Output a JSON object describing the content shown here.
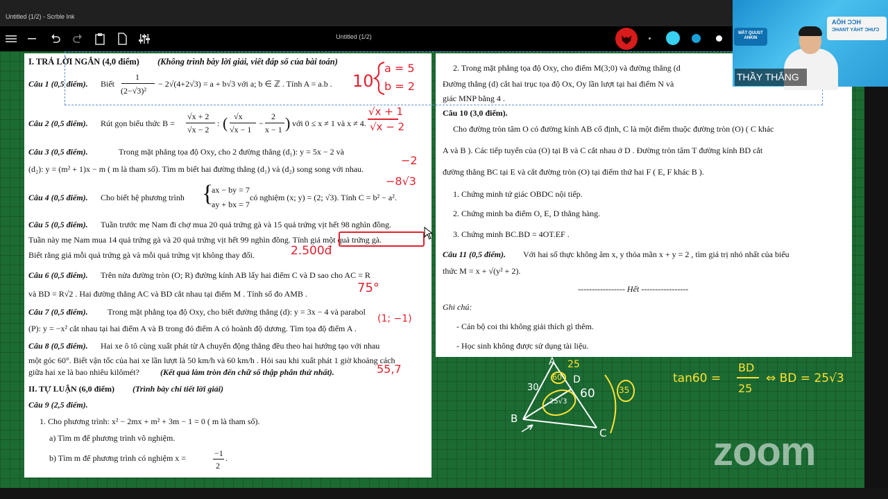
{
  "window": {
    "title": "Untitled (1/2) - Scrble Ink",
    "document_title": "Untitled (1/2)"
  },
  "toolbar": {
    "icons": [
      "menu-icon",
      "undo-icon",
      "redo-icon",
      "clipboard-icon",
      "page-icon",
      "sliders-icon",
      "fox-icon",
      "laser-icon"
    ]
  },
  "ink_colors": {
    "red": "#e0202d",
    "cyan": "#37d0f0",
    "teal": "#16a0d8",
    "white": "#ffffff",
    "yellow": "#ffe234"
  },
  "webcam": {
    "banner_line1": "AÔH ƆƆH",
    "banner_line2": "ƆHANT YẢHT ƆHƯƆ",
    "logo": "MẮT QUUST ANKIN",
    "name": "THẦY THẮNG"
  },
  "left_page": {
    "header": "I. TRẢ LỜI NGẮN (4,0 điểm)",
    "header_note": "(Không trình bày lời giải, viết đáp số của bài toán)",
    "q1_label": "Câu 1 (0,5 điểm).",
    "q1_pre": "Biết",
    "q1_frac_num": "1",
    "q1_frac_den": "(2−√3)²",
    "q1_rest": "− 2√(4+2√3) = a + b√3  với  a; b ∈ ℤ . Tính  A = a.b .",
    "q2_label": "Câu 2 (0,5 điểm).",
    "q2_pre": "Rút gọn biểu thức  B =",
    "q2_f1_num": "√x + 2",
    "q2_f1_den": "√x − 2",
    "q2_mid": ":",
    "q2_f2_num": "√x",
    "q2_f2_den": "√x − 1",
    "q2_minus": "−",
    "q2_f3_num": "2",
    "q2_f3_den": "x − 1",
    "q2_rest": "với  0 ≤ x ≠ 1  và  x ≠ 4.",
    "q3_label": "Câu 3 (0,5 điểm).",
    "q3_l1": "Trong mặt phẳng tọa độ  Oxy,  cho 2 đường thẳng  (d₁): y = 5x − 2  và",
    "q3_l2": "(d₂): y = (m² + 1)x − m  ( m  là tham số). Tìm  m  biết hai đường thẳng  (d₁)  và  (d₂)  song song với nhau.",
    "q4_label": "Câu 4 (0,5 điểm).",
    "q4_pre": "Cho biết hệ phương trình",
    "q4_sys1": "ax − by = 7",
    "q4_sys2": "ay + bx = 7",
    "q4_rest": "có nghiệm  (x; y) = (2; √3).  Tính  C = b² − a².",
    "q5_label": "Câu 5 (0,5 điểm).",
    "q5_l1": "Tuần trước mẹ Nam đi chợ mua  20  quả trứng gà và 15 quả trứng vịt hết  98  nghìn đồng.",
    "q5_l2": "Tuần này mẹ Nam mua 14 quả trứng gà và  20  quả trứng vịt hết 99  nghìn đồng. Tính giá một quả trứng gà.",
    "q5_l3": "Biết rằng giá mỗi quả trứng gà và mỗi quả trứng vịt không thay đổi.",
    "q6_label": "Câu 6 (0,5 điểm).",
    "q6_l1": "Trên nửa đường tròn  (O; R)  đường kính  AB  lấy hai điểm  C  và  D  sao cho  AC = R",
    "q6_l2": "và  BD = R√2 . Hai đường thẳng  AC  và  BD  cắt nhau tại điểm  M . Tính số đo  AMB .",
    "q7_label": "Câu 7 (0,5 điểm).",
    "q7_l1": "Trong mặt phẳng tọa độ  Oxy,  cho biết đường thẳng  (d): y = 3x − 4  và parabol",
    "q7_l2": "(P): y = −x²  cắt nhau tại hai điểm  A  và  B  trong đó điểm  A  có hoành độ dương. Tìm tọa độ điểm  A .",
    "q8_label": "Câu 8 (0,5 điểm).",
    "q8_l1": "Hai xe ô tô cùng xuất phát từ  A  chuyển động thẳng đều theo hai hướng tạo với nhau",
    "q8_l2": "một góc 60°. Biết vận tốc của hai xe lần lượt là 50 km/h và 60 km/h . Hỏi sau khi xuất phát 1 giờ khoảng cách",
    "q8_l3": "giữa hai xe là bao nhiêu kilômét?",
    "q8_note": "(Kết quả làm tròn đến chữ số thập phân thứ nhất).",
    "part2": "II. TỰ LUẬN (6,0 điểm)",
    "part2_note": "(Trình bày chi tiết lời giải)",
    "q9_label": "Câu 9 (2,5 điểm).",
    "q9_1": "1. Cho phương trình:  x² − 2mx + m² + 3m − 1 = 0  ( m  là tham số).",
    "q9_1a": "a) Tìm  m  để phương trình vô nghiệm.",
    "q9_1b_pre": "b) Tìm  m  để phương trình có nghiệm  x =",
    "q9_1b_num": "−1",
    "q9_1b_den": "2",
    "q9_1b_end": "."
  },
  "right_page": {
    "q9_2_l1": "2. Trong mặt phẳng tọa độ  Oxy,  cho điểm  M(3;0)  và đường thẳng  (d",
    "q9_2_l2": "Đường thẳng  (d)  cắt hai trục tọa độ  Ox,  Oy  lần lượt tại hai điểm  N  và",
    "q9_2_l3": "giác  MNP  bằng 4 .",
    "q10_label": "Câu 10 (3,0 điểm).",
    "q10_l1": "Cho đường tròn tâm  O  có đường kính  AB  cố định,  C  là một điểm thuộc đường tròn  (O)  ( C  khác",
    "q10_l2": "A  và  B ). Các tiếp tuyến của  (O)  tại  B  và  C  cắt nhau ở  D . Đường tròn tâm  T  đường kính  BD  cắt",
    "q10_l3": "đường thẳng  BC  tại  E  và cắt đường tròn  (O)  tại điểm thứ hai  F  ( E, F  khác  B ).",
    "q10_1": "1. Chứng minh tứ giác  OBDC  nội tiếp.",
    "q10_2": "2. Chứng minh ba điểm  O, E, D  thẳng hàng.",
    "q10_3": "3. Chứng minh  BC.BD = 4OT.EF .",
    "q11_label": "Câu 11 (0,5 điểm).",
    "q11_l1": "Với hai số thực không âm  x, y  thỏa mãn  x + y = 2 , tìm giá trị nhỏ nhất của biểu",
    "q11_l2": "thức  M = x + √(y² + 2).",
    "end": "----------------- Hết -----------------",
    "note_label": "Ghi chú:",
    "note1": "- Cán bộ coi thi không giải thích gì thêm.",
    "note2": "- Học sinh không được sử dụng tài liệu."
  },
  "ink_notes": {
    "q1_answer": "10",
    "q1_a": "a = 5",
    "q1_b": "b = 2",
    "q2_num": "√x + 1",
    "q2_den": "√x − 2",
    "q3_answer": "−2",
    "q4_answer": "−8√3",
    "q5_answer": "2.500đ",
    "q6_answer": "75°",
    "q7_answer": "(1; −1)",
    "q8_answer": "55,7",
    "fig_A": "A",
    "fig_B": "B",
    "fig_C": "C",
    "fig_D": "D",
    "fig_25": "25",
    "fig_30": "30",
    "fig_60": "60",
    "fig_angle": "60°",
    "fig_area": "25√3",
    "fig_circ": "35",
    "tan_lhs": "tan60 =",
    "tan_num": "BD",
    "tan_den": "25",
    "tan_rhs": "⇔ BD = 25√3"
  },
  "watermark": "zoom"
}
